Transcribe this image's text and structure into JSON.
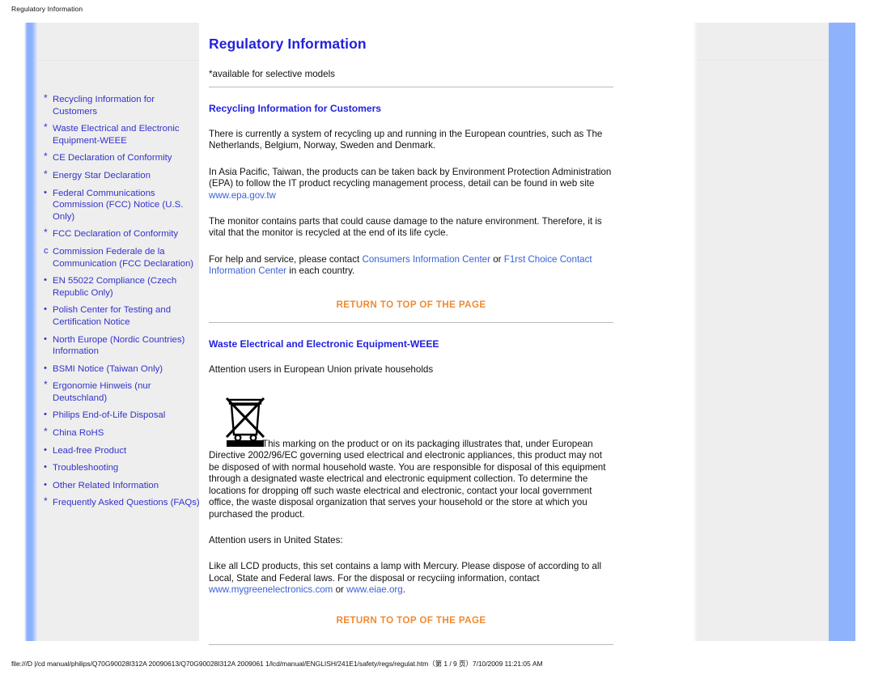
{
  "print": {
    "header": "Regulatory Information",
    "footer": "file:///D |/cd manual/philips/Q70G90028I312A 20090613/Q70G90028I312A 2009061 1/lcd/manual/ENGLISH/241E1/safety/regs/regulat.htm（第 1 / 9 页）7/10/2009 11:21:05 AM"
  },
  "colors": {
    "link_blue": "#3333cc",
    "heading_blue": "#2222dd",
    "return_orange": "#f08a33",
    "panel_gray": "#eeeeee",
    "accent_bar_blue": "#8fb2fd"
  },
  "sidebar": {
    "items": [
      {
        "bullet": "*",
        "bullet_kind": "ast",
        "label": "Recycling Information for Customers"
      },
      {
        "bullet": "*",
        "bullet_kind": "ast",
        "label": "Waste Electrical and Electronic Equipment-WEEE"
      },
      {
        "bullet": "*",
        "bullet_kind": "ast",
        "label": "CE Declaration of Conformity"
      },
      {
        "bullet": "*",
        "bullet_kind": "ast",
        "label": "Energy Star Declaration"
      },
      {
        "bullet": "•",
        "bullet_kind": "char",
        "label": "Federal Communications Commission (FCC) Notice (U.S. Only)"
      },
      {
        "bullet": "*",
        "bullet_kind": "ast",
        "label": "FCC Declaration of Conformity"
      },
      {
        "bullet": "c",
        "bullet_kind": "char",
        "label": "Commission Federale de la Communication (FCC Declaration)"
      },
      {
        "bullet": "•",
        "bullet_kind": "char",
        "label": "EN 55022 Compliance (Czech Republic Only)"
      },
      {
        "bullet": "•",
        "bullet_kind": "char",
        "label": "Polish Center for Testing and Certification Notice"
      },
      {
        "bullet": "•",
        "bullet_kind": "char",
        "label": "North Europe (Nordic Countries) Information"
      },
      {
        "bullet": "•",
        "bullet_kind": "char",
        "label": "BSMI Notice (Taiwan Only)"
      },
      {
        "bullet": "*",
        "bullet_kind": "ast",
        "label": "Ergonomie Hinweis (nur Deutschland)"
      },
      {
        "bullet": "•",
        "bullet_kind": "char",
        "label": "Philips End-of-Life Disposal"
      },
      {
        "bullet": "*",
        "bullet_kind": "ast",
        "label": "China RoHS"
      },
      {
        "bullet": "•",
        "bullet_kind": "char",
        "label": "Lead-free Product"
      },
      {
        "bullet": "•",
        "bullet_kind": "char",
        "label": "Troubleshooting"
      },
      {
        "bullet": "•",
        "bullet_kind": "char",
        "label": "Other Related Information"
      },
      {
        "bullet": "*",
        "bullet_kind": "ast",
        "label": "Frequently Asked Questions (FAQs)"
      }
    ]
  },
  "main": {
    "title": "Regulatory Information",
    "note": "*available for selective models",
    "recycling": {
      "heading": "Recycling Information for Customers",
      "p1": "There is currently a system of recycling up and running in the European countries, such as The Netherlands, Belgium, Norway, Sweden and Denmark.",
      "p2_before": "In Asia Pacific, Taiwan, the products can be taken back by Environment Protection Administration (EPA) to follow the IT product recycling management process, detail can be found in web site ",
      "p2_link": "www.epa.gov.tw",
      "p3": "The monitor contains parts that could cause damage to the nature environment. Therefore, it is vital that the monitor is recycled at the end of its life cycle.",
      "p4_before": "For help and service, please contact ",
      "p4_link1": "Consumers Information Center",
      "p4_mid": " or ",
      "p4_link2": "F1rst Choice Contact Information Center",
      "p4_after": " in each country."
    },
    "return_to_top": "RETURN TO TOP OF THE PAGE",
    "weee": {
      "heading": "Waste Electrical and Electronic Equipment-WEEE",
      "attention_eu": "Attention users in European Union private households",
      "marking_text": "This marking on the product or on its packaging illustrates that, under European Directive 2002/96/EC governing used electrical and electronic appliances, this product may not be disposed of with normal household waste. You are responsible for disposal of this equipment through a designated waste electrical and electronic equipment collection. To determine the locations for dropping off such waste electrical and electronic, contact your local government office, the waste disposal organization that serves your household or the store at which you purchased the product.",
      "attention_us": "Attention users in United States:",
      "mercury_before": "Like all LCD products, this set contains a lamp with Mercury. Please dispose of according to all Local, State and Federal laws. For the disposal or recyciing information, contact ",
      "mercury_link1": "www.mygreenelectronics.com",
      "mercury_mid": " or ",
      "mercury_link2": "www.eiae.org",
      "mercury_after": "."
    }
  }
}
